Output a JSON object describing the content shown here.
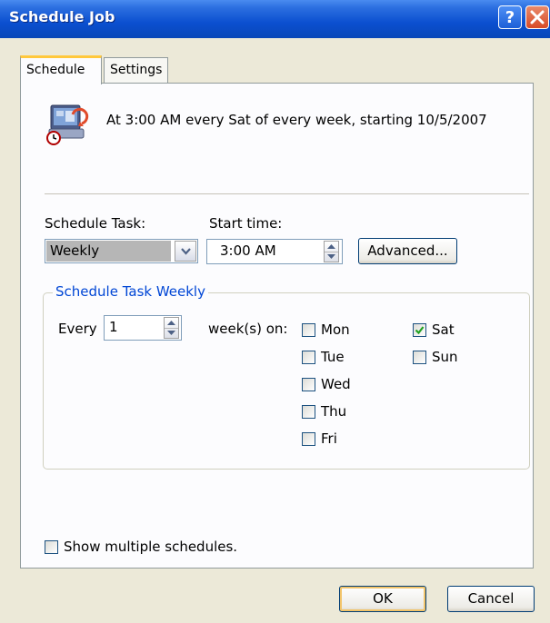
{
  "window": {
    "title": "Schedule Job",
    "help_label": "?"
  },
  "tabs": [
    {
      "label": "Schedule",
      "active": true
    },
    {
      "label": "Settings",
      "active": false
    }
  ],
  "summary": {
    "text": "At 3:00 AM every Sat of every week, starting 10/5/2007",
    "icon": "scheduled-task-icon"
  },
  "schedule_task": {
    "label": "Schedule Task:",
    "value": "Weekly"
  },
  "start_time": {
    "label": "Start time:",
    "value": "3:00 AM"
  },
  "advanced_label": "Advanced...",
  "weekly_group": {
    "legend": "Schedule Task Weekly",
    "every_label": "Every",
    "every_value": "1",
    "weeks_on_label": "week(s) on:",
    "days": [
      {
        "label": "Mon",
        "checked": false
      },
      {
        "label": "Tue",
        "checked": false
      },
      {
        "label": "Wed",
        "checked": false
      },
      {
        "label": "Thu",
        "checked": false
      },
      {
        "label": "Fri",
        "checked": false
      },
      {
        "label": "Sat",
        "checked": true
      },
      {
        "label": "Sun",
        "checked": false
      }
    ]
  },
  "show_multiple": {
    "label": "Show multiple schedules.",
    "checked": false
  },
  "buttons": {
    "ok": "OK",
    "cancel": "Cancel"
  },
  "colors": {
    "title_bar": "#0b4fd0",
    "group_legend": "#0046d5",
    "dialog_bg": "#ece9d8"
  }
}
